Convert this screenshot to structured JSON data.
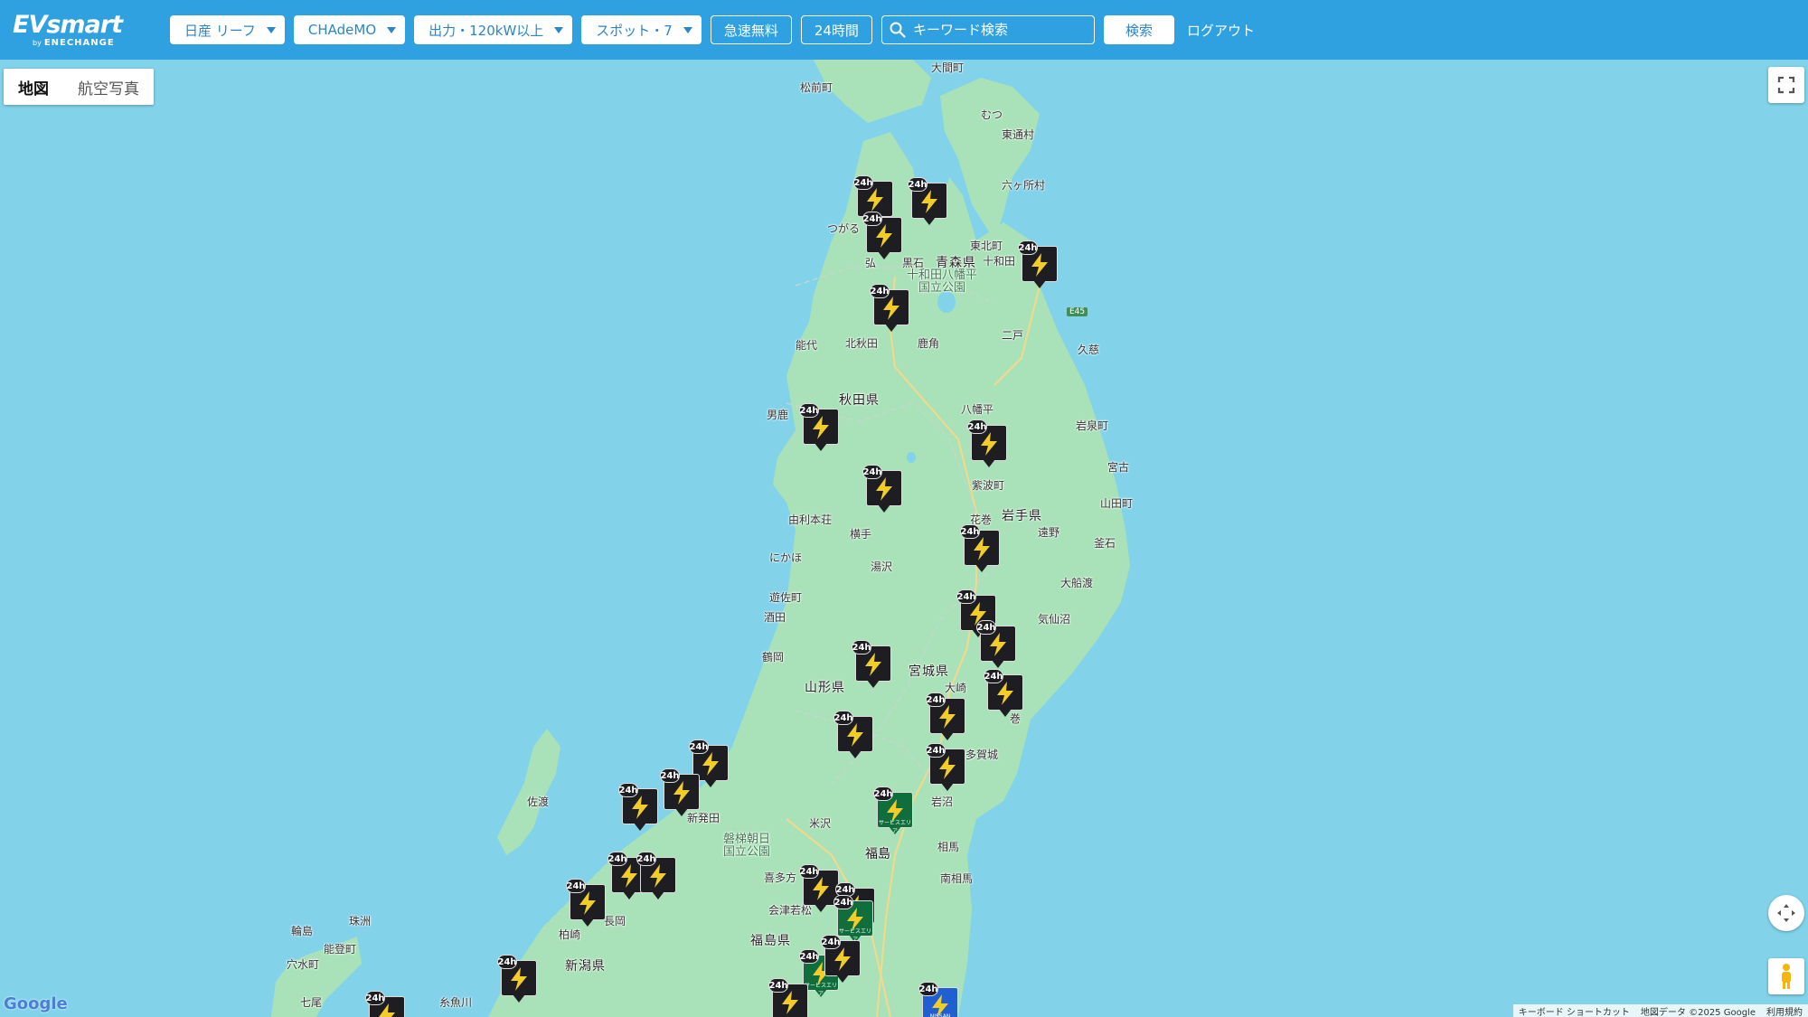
{
  "header": {
    "logo": "EVsmart",
    "logo_sub_by": "by",
    "logo_sub": "ENECHANGE",
    "filters": [
      {
        "label": "日産 リーフ"
      },
      {
        "label": "CHAdeMO"
      },
      {
        "label": "出力・120kW以上"
      },
      {
        "label": "スポット・7"
      }
    ],
    "toggles": [
      {
        "label": "急速無料"
      },
      {
        "label": "24時間"
      }
    ],
    "search_placeholder": "キーワード検索",
    "search_button": "検索",
    "logout": "ログアウト"
  },
  "map": {
    "map_types": [
      {
        "label": "地図",
        "active": true
      },
      {
        "label": "航空写真",
        "active": false
      }
    ],
    "labels": {
      "ominato": "大間町",
      "matsumae": "松前町",
      "mutsu": "むつ",
      "higashidori": "東通村",
      "rokkasho": "六ヶ所村",
      "tsugaru": "つがる",
      "aomori_pref": "青森県",
      "towada": "十和田",
      "higashikita": "東北町",
      "hirosaki": "弘",
      "kuroishi": "黒石",
      "park_towada": "十和田八幡平\n国立公園",
      "e45": "E45",
      "ninohe": "二戸",
      "kuji": "久慈",
      "noshiro": "能代",
      "kitaakita": "北秋田",
      "kazuno": "鹿角",
      "oga": "男鹿",
      "akita_pref": "秋田県",
      "hachimantai": "八幡平",
      "iwaizumi": "岩泉町",
      "miyako": "宮古",
      "shiwa": "紫波町",
      "yamada": "山田町",
      "iwate_pref": "岩手県",
      "hanamaki": "花巻",
      "tono": "遠野",
      "kamaishi": "釜石",
      "yurihonjo": "由利本荘",
      "yokote": "横手",
      "nikaho": "にかほ",
      "yuzawa": "湯沢",
      "ofunato": "大船渡",
      "yuza": "遊佐町",
      "sakata": "酒田",
      "kesennuma": "気仙沼",
      "tsuruoka": "鶴岡",
      "miyagi_pref": "宮城県",
      "osaki": "大崎",
      "yamagata_pref": "山形県",
      "ishinomaki": "巻",
      "tagajo": "多賀城",
      "sado": "佐渡",
      "shibata": "新発田",
      "iwanuma": "岩沼",
      "yonezawa": "米沢",
      "park_bandai": "磐梯朝日\n国立公園",
      "fukushima": "福島",
      "soma": "相馬",
      "minamisoma": "南相馬",
      "kitakata": "喜多方",
      "aizu": "会津若松",
      "suzu": "珠洲",
      "wajima": "輪島",
      "noto": "能登町",
      "kashiwazaki": "柏崎",
      "nagaoka": "長岡",
      "fukushima_pref": "福島県",
      "anamizu": "穴水町",
      "niigata_pref": "新潟県",
      "nanao": "七尾",
      "itoigawa": "糸魚川"
    },
    "marker_badge": "24h",
    "sa_label": "サービスエリア",
    "nissan_label": "NISSAN",
    "google": "Google",
    "footer": [
      "キーボード ショートカット",
      "地図データ ©2025 Google",
      "利用規約"
    ]
  },
  "colors": {
    "header": "#2fa0e0",
    "sea": "#82d3ea",
    "land": "#a9e2b8",
    "marker_dark": "#1e1e22",
    "marker_green": "#0f6e3b",
    "marker_blue": "#1f5fcf",
    "bolt": "#f2cd2a"
  }
}
